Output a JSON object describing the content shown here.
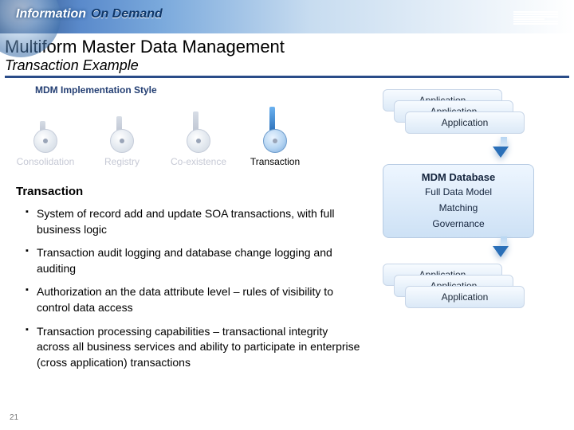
{
  "banner": {
    "brand1": "Information",
    "brand2": "On Demand",
    "logo": "IBM"
  },
  "title": "Multiform Master Data Management",
  "subtitle": "Transaction Example",
  "section_label": "MDM Implementation Style",
  "styles": [
    "Consolidation",
    "Registry",
    "Co-existence",
    "Transaction"
  ],
  "heading": "Transaction",
  "bullets": [
    "System of record add and update SOA transactions, with full business logic",
    "Transaction audit logging and database change logging and auditing",
    "Authorization an the data attribute level – rules of visibility to control data access",
    "Transaction processing capabilities – transactional integrity across all business services and ability to participate in enterprise (cross application) transactions"
  ],
  "diagram": {
    "app_label": "Application",
    "mdm_title": "MDM Database",
    "mdm_lines": [
      "Full Data Model",
      "Matching",
      "Governance"
    ]
  },
  "page_number": "21"
}
